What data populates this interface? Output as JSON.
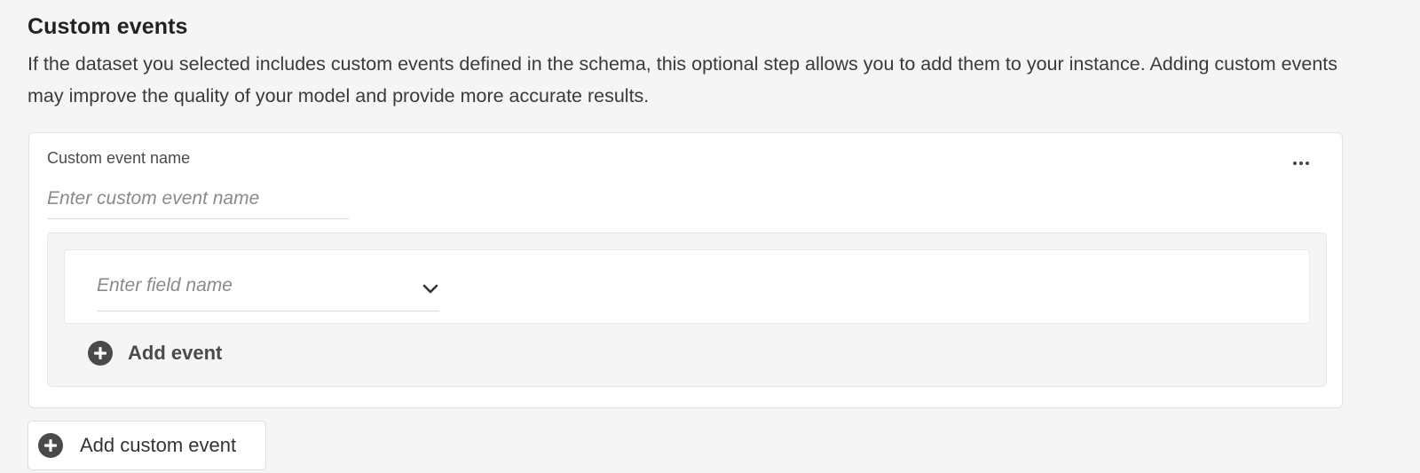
{
  "section": {
    "title": "Custom events",
    "description": "If the dataset you selected includes custom events defined in the schema, this optional step allows you to add them to your instance. Adding custom events may improve the quality of your model and provide more accurate results."
  },
  "event_card": {
    "name_label": "Custom event name",
    "name_placeholder": "Enter custom event name",
    "more_icon": "more-horizontal-icon",
    "field_picker": {
      "placeholder": "Enter field name",
      "icon": "chevron-down-icon"
    },
    "add_event_label": "Add event",
    "add_event_icon": "add-circle-icon"
  },
  "footer": {
    "add_custom_event_label": "Add custom event",
    "add_custom_event_icon": "add-circle-icon"
  },
  "colors": {
    "background": "#f5f5f5",
    "card": "#ffffff",
    "icon": "#4a4a4a"
  }
}
